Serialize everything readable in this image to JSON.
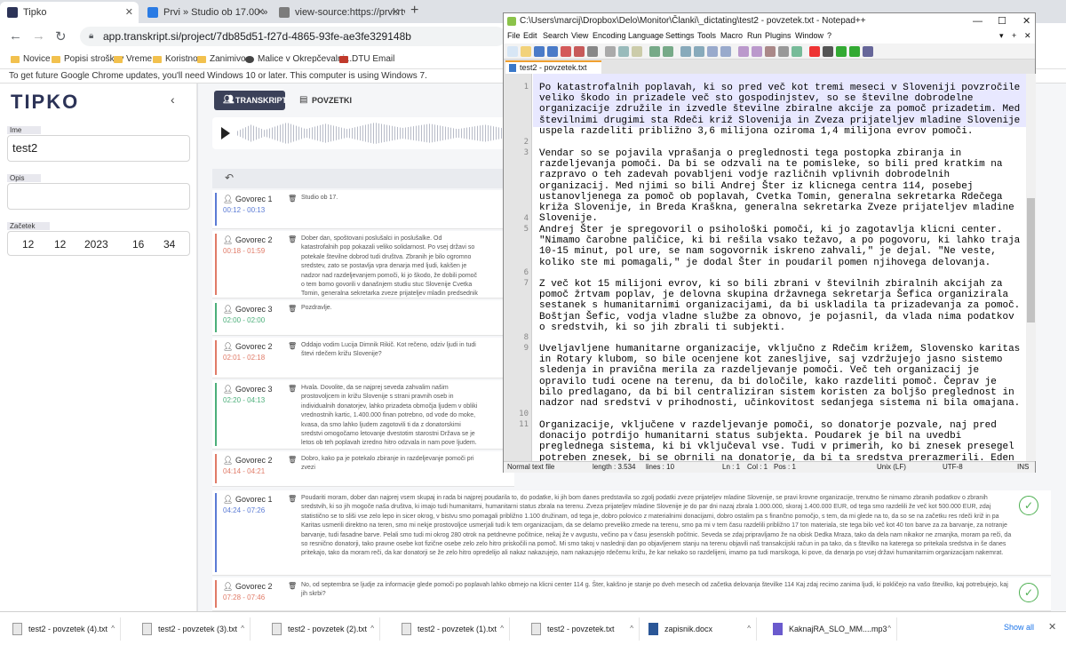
{
  "browser": {
    "tabs": [
      {
        "title": "Tipko",
        "color": "#2c3357"
      },
      {
        "title": "Prvi » Studio ob 17.00 » Kakšna je s...",
        "color": "#2a7be4"
      },
      {
        "title": "view-source:https://prvi.rtvslo.si",
        "color": "#7c7c7c"
      }
    ],
    "url": "app.transkript.si/project/7db85d51-f27d-4865-93fe-ae3fe329148b",
    "bookmarks": [
      "Novice",
      "Popisi stroškov",
      "Vreme",
      "Koristno",
      "Zanimivo",
      "Malice v Okrepčevalni...",
      "DTU Email"
    ],
    "infobar": "To get future Google Chrome updates, you'll need Windows 10 or later. This computer is using Windows 7."
  },
  "tipko": {
    "logo": "TIPKO",
    "name_label": "Ime",
    "name_value": "test2",
    "desc_label": "Opis",
    "start_label": "Začetek",
    "date": {
      "day": "12",
      "month": "12",
      "year": "2023",
      "hour": "16",
      "minute": "34"
    },
    "tab_transcript": "TRANSKRIPT",
    "tab_summaries": "POVZETKI",
    "segments": [
      {
        "speaker": "Govorec 1",
        "time": "00:12 - 00:13",
        "color": "#5b7bd5",
        "text": "Studio ob 17."
      },
      {
        "speaker": "Govorec 2",
        "time": "00:18 - 01:59",
        "color": "#e07b68",
        "text": "Dober dan, spoštovani poslušalci in poslušalke. Od katastrofalnih pop pokazali veliko solidarnost. Po vsej državi so potekale številne dobrod tudi društva. Zbranih je bilo ogromno sredstev, zato se postavlja vpra denarja med ljudi, kakšen je nadzor nad razdeljevanjem pomoči, ki jo škodo, že dobili pomoč o tem bomo govorili v današnjem studiu stuc Slovenije Cvetka Tomin, generalna sekretarka zveze prijateljev mladin predsednik sveta radiotelevizije Slovenija, vendar danes v naši oddaji"
      },
      {
        "speaker": "Govorec 3",
        "time": "02:00 - 02:00",
        "color": "#4caf7a",
        "text": "Pozdravlje."
      },
      {
        "speaker": "Govorec 2",
        "time": "02:01 - 02:18",
        "color": "#e07b68",
        "text": "Oddajo vodim Lucija Dimnik Rikič. Kot rečeno, odziv ljudi in tudi števi rdečem križu Slovenije?"
      },
      {
        "speaker": "Govorec 3",
        "time": "02:20 - 04:13",
        "color": "#4caf7a",
        "text": "Hvala. Dovolite, da se najprej seveda zahvalim našim prostovoljcem in križu Slovenije s strani pravnih oseb in individualnih donatorjev, lahko prizadeta območja ljudem v obliki vrednostnih kartic, 1.400.000 finan potrebno, od vode do moke, kvasa, da smo lahko ljudem zagotovili ti da z donatorskimi sredstvi omogočamo letovanje dvestotim starostni Država se je letos ob teh poplavah izredno hitro odzvala in nam pove ljudem."
      },
      {
        "speaker": "Govorec 2",
        "time": "04:14 - 04:21",
        "color": "#e07b68",
        "text": "Dobro, kako pa je potekalo zbiranje in razdeljevanje pomoči pri zvezi"
      },
      {
        "speaker": "Govorec 1",
        "time": "04:24 - 07:26",
        "color": "#5b7bd5",
        "text": "Poudariti moram, dober dan najprej vsem skupaj in rada bi najprej poudarila to, do podatke, ki jih bom danes predstavila so zgolj podatki zveze prijateljev mladine Slovenije, se pravi krovne organizacije, trenutno še nimamo zbranih podatkov o zbranih sredstvih, ki so jih mogoče naša društva, ki imajo tudi humanitarni, humanitarni status zbrala na terenu. Zveza prijateljev mladine Slovenije je do par dni nazaj zbrala 1.000.000, skoraj 1.400.000 EUR, od tega smo razdelili že več kot 500.000 EUR, zdaj statistično se to sliši vse zelo lepo in sicer okrog, v bistvu smo pomagali približno 1.100 družinam, od tega je, dobro polovico z materialnimi donacijami, dobro ostalim pa s finančno pomočjo, s tem, da mi glede na to, da so se na začetku res rdeči križ in pa Karitas usmerili direktno na teren, smo mi nekje prostovoljce usmerjali tudi k tem organizacijam, da se delamo preveliko zmede na terenu, smo pa mi v tem času razdelili približno 17 ton materiala, ste tega bilo več kot 40 ton barve za za barvanje, za notranje barvanje, tudi fasadne barve. Pelali smo tudi mi okrog 280 otrok na petdnevne počitnice, nekaj že v avgustu, večino pa v času jesenskih počitnic. Seveda se zdaj pripravljamo že na obisk Dedka Mraza, tako da dela nam nikakor ne zmanjka, moram pa reči, da so resnično donatorji, tako pravne osebe kot fizične osebe zelo zelo hitro priskočili na pomoč. Mi smo takoj v naslednji dan po objavljenem stanju na terenu objavili naš transakcijski račun in pa tako, da s številko na katerega so pritekala sredstva in še danes pritekajo, tako da moram reči, da kar donatorji se že zelo hitro opredelijo ali nakaz nakazujejo, nam nakazujejo rdečemu križu, že kar nekako so razdelijeni, imamo pa tudi marsikoga, ki pove, da denarja po vsej državi humanitarnim organizacijam nakemrat."
      },
      {
        "speaker": "Govorec 2",
        "time": "07:28 - 07:46",
        "color": "#e07b68",
        "text": "No, od septembra se ljudje za informacije glede pomoči po poplavah lahko obrnejo na klicni center 114 g. Šter, kakšno je stanje po dveh mesecih od začetka delovanja številke 114 Kaj zdaj recimo zanima ljudi, ki pokličejo na vašo številko, kaj potrebujejo, kaj jih skrbi?"
      }
    ]
  },
  "notepad": {
    "title": "C:\\Users\\marcij\\Dropbox\\Delo\\Monitor\\Članki\\_dictating\\test2 - povzetek.txt - Notepad++",
    "menu": [
      "File",
      "Edit",
      "Search",
      "View",
      "Encoding",
      "Language",
      "Settings",
      "Tools",
      "Macro",
      "Run",
      "Plugins",
      "Window",
      "?"
    ],
    "tab": "test2 - povzetek.txt",
    "lines": [
      {
        "n": "1",
        "text": "Po katastrofalnih poplavah, ki so pred več kot tremi meseci v Sloveniji povzročile veliko škodo in prizadele več sto gospodinjstev, so se številne dobrodelne organizacije združile in izvedle številne zbiralne akcije za pomoč prizadetim. Med številnimi drugimi sta Rdeči križ Slovenija in Zveza prijateljev mladine Slovenije uspela razdeliti približno 3,6 milijona oziroma 1,4 milijona evrov pomoči."
      },
      {
        "n": "2",
        "text": ""
      },
      {
        "n": "3",
        "text": "Vendar so se pojavila vprašanja o preglednosti tega postopka zbiranja in razdeljevanja pomoči. Da bi se odzvali na te pomisleke, so bili pred kratkim na razpravo o teh zadevah povabljeni vodje različnih vplivnih dobrodelnih organizacij. Med njimi so bili Andrej Šter iz klicnega centra 114, posebej ustanovljenega za pomoč ob poplavah, Cvetka Tomin, generalna sekretarka Rdečega križa Slovenije, in Breda Kraškna, generalna sekretarka Zveze prijateljev mladine Slovenije."
      },
      {
        "n": "4",
        "text": ""
      },
      {
        "n": "5",
        "text": "Andrej Šter je spregovoril o psihološki pomoči, ki jo zagotavlja klicni center. \"Nimamo čarobne paličice, ki bi rešila vsako težavo, a po pogovoru, ki lahko traja 10-15 minut, pol ure, se nam sogovornik iskreno zahvali,\" je dejal. \"Ne veste, koliko ste mi pomagali,\" je dodal Šter in poudaril pomen njihovega delovanja."
      },
      {
        "n": "6",
        "text": ""
      },
      {
        "n": "7",
        "text": "Z več kot 15 milijoni evrov, ki so bili zbrani v številnih zbiralnih akcijah za pomoč žrtvam poplav, je delovna skupina državnega sekretarja Šefica organizirala sestanek s humanitarnimi organizacijami, da bi uskladila ta prizadevanja za pomoč. Boštjan Šefic, vodja vladne službe za obnovo, je pojasnil, da vlada nima podatkov o sredstvih, ki so jih zbrali ti subjekti."
      },
      {
        "n": "8",
        "text": ""
      },
      {
        "n": "9",
        "text": "Uveljavljene humanitarne organizacije, vključno z Rdečim križem, Slovensko karitas in Rotary klubom, so bile ocenjene kot zanesljive, saj vzdržujejo jasno sistemo sledenja in pravična merila za razdeljevanje pomoči. Več teh organizacij je opravilo tudi ocene na terenu, da bi določile, kako razdeliti pomoč. Čeprav je bilo predlagano, da bi bil centraliziran sistem koristen za boljšo preglednost in nadzor nad sredstvi v prihodnosti, učinkovitost sedanjega sistema ni bila omajana."
      },
      {
        "n": "10",
        "text": ""
      },
      {
        "n": "11",
        "text": "Organizacije, vključene v razdeljevanje pomoči, so donatorje pozvale, naj pred donacijo potrdijo humanitarni status subjekta. Poudarek je bil na uvedbi preglednega sistema, ki bi vključeval vse. Tudi v primerih, ko bi znesek presegel potreben znesek, bi se obrnili na donatorje, da bi ta sredstva prerazmerili. Eden od predstavnikov je poudaril: \"Da bi se izognili zapletom, se moramo dogovoriti s"
      }
    ],
    "status": {
      "type": "Normal text file",
      "length": "length : 3.534",
      "lines": "lines : 10",
      "ln": "Ln : 1",
      "col": "Col : 1",
      "pos": "Pos : 1",
      "eol": "Unix (LF)",
      "enc": "UTF-8",
      "ins": "INS"
    }
  },
  "downloads": {
    "items": [
      "test2 - povzetek (4).txt",
      "test2 - povzetek (3).txt",
      "test2 - povzetek (2).txt",
      "test2 - povzetek (1).txt",
      "test2 - povzetek.txt",
      "zapisnik.docx",
      "KaknajRA_SLO_MM....mp3"
    ],
    "show_all": "Show all"
  }
}
